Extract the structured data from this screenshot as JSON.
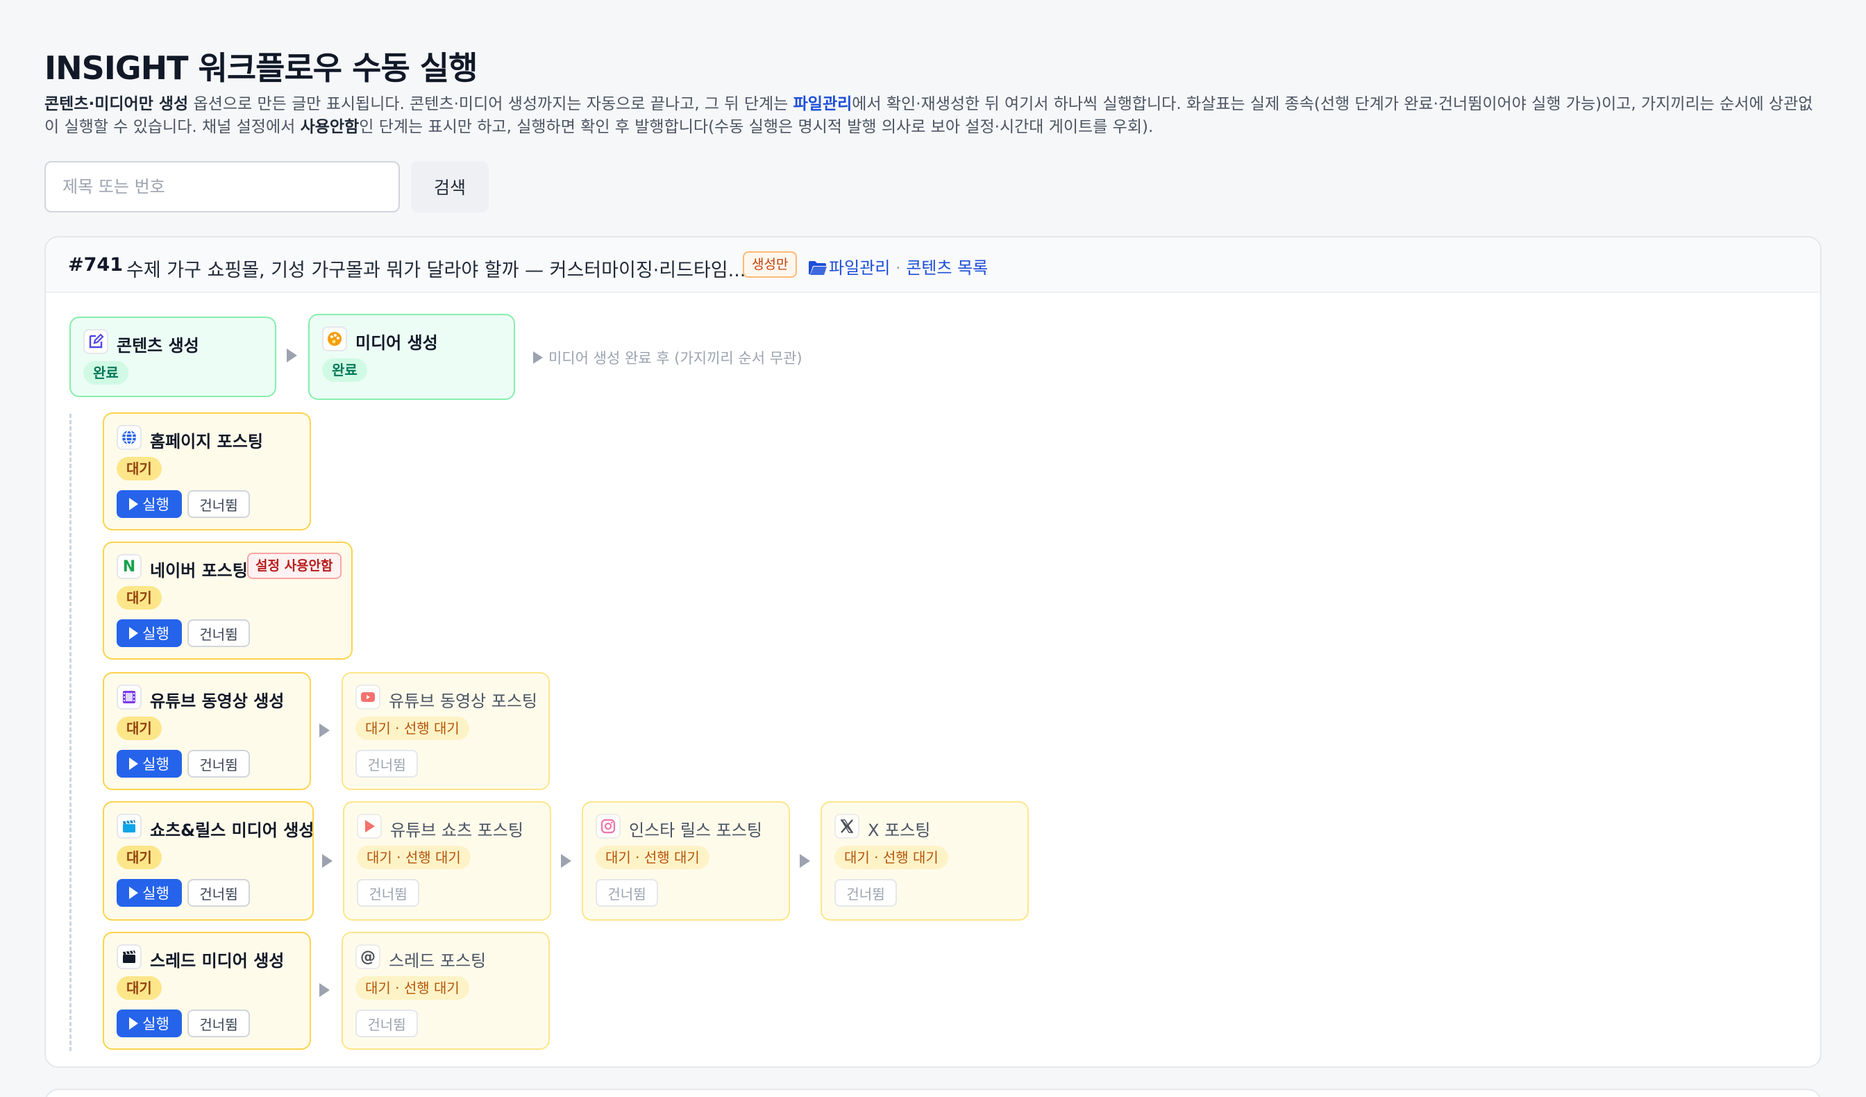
{
  "page": {
    "title": "INSIGHT 워크플로우 수동 실행",
    "desc": {
      "p1": "콘텐츠·미디어만 생성",
      "p2": " 옵션으로 만든 글만 표시됩니다. 콘텐츠·미디어 생성까지는 자동으로 끝나고, 그 뒤 단계는 ",
      "p3": "파일관리",
      "p4": "에서 확인·재생성한 뒤 여기서 하나씩 실행합니다. 화살표는 실제 종속(선행 단계가 완료·건너뜀이어야 실행 가능)이고, 가지끼리는 순서에 상관없이 실행할 수 있습니다. 채널 설정에서 ",
      "p5": "사용안함",
      "p6": "인 단계는 표시만 하고, 실행하면 확인 후 발행합니다(수동 실행은 명시적 발행 의사로 보아 설정·시간대 게이트를 우회)."
    }
  },
  "search": {
    "placeholder": "제목 또는 번호",
    "value": "",
    "button": "검색"
  },
  "item": {
    "number": "#741",
    "title": "수제 가구 쇼핑몰, 기성 가구몰과 뭐가 달라야 할까 — 커스터마이징·리드타임...",
    "badge": "생성만",
    "link_files": "파일관리",
    "separator": " · ",
    "link_list": "콘텐츠 목록"
  },
  "labels": {
    "run": "실행",
    "skip": "건너뜀",
    "disabled": "설정 사용안함",
    "note": "미디어 생성 완료 후 (가지끼리 순서 무관)"
  },
  "steps": {
    "content": {
      "label": "콘텐츠 생성",
      "status": "완료",
      "icon": "edit-icon"
    },
    "media": {
      "label": "미디어 생성",
      "status": "완료",
      "icon": "palette-icon"
    },
    "homepage": {
      "label": "홈페이지 포스팅",
      "status": "대기",
      "icon": "globe-icon"
    },
    "naver": {
      "label": "네이버 포스팅",
      "status": "대기",
      "icon": "naver-icon",
      "icon_text": "N"
    },
    "youtube_video": {
      "label": "유튜브 동영상 생성",
      "status": "대기",
      "icon": "film-icon"
    },
    "youtube_post": {
      "label": "유튜브 동영상 포스팅",
      "status": "대기 · 선행 대기",
      "icon": "youtube-icon"
    },
    "shorts_media": {
      "label": "쇼츠&릴스 미디어 생성",
      "status": "대기",
      "icon": "clapper-icon"
    },
    "youtube_shorts": {
      "label": "유튜브 쇼츠 포스팅",
      "status": "대기 · 선행 대기",
      "icon": "play-icon"
    },
    "insta_reels": {
      "label": "인스타 릴스 포스팅",
      "status": "대기 · 선행 대기",
      "icon": "instagram-icon"
    },
    "x_post": {
      "label": "X 포스팅",
      "status": "대기 · 선행 대기",
      "icon": "x-icon"
    },
    "threads_media": {
      "label": "스레드 미디어 생성",
      "status": "대기",
      "icon": "clapperboard-icon"
    },
    "threads_post": {
      "label": "스레드 포스팅",
      "status": "대기 · 선행 대기",
      "icon": "threads-icon",
      "icon_text": "@"
    }
  },
  "colors": {
    "primary": "#2563eb",
    "done_bg": "#ecfdf5",
    "wait_bg": "#fffbeb",
    "danger": "#b91c1c"
  }
}
